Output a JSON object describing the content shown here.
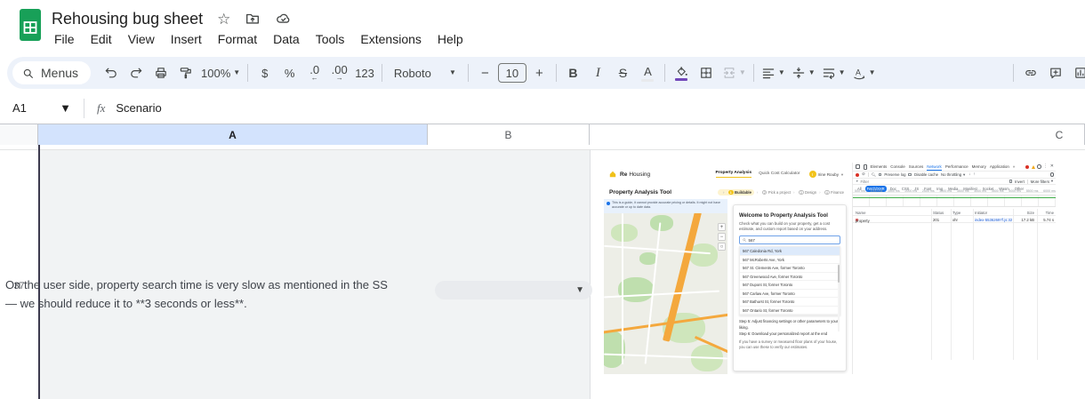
{
  "titlebar": {
    "title": "Rehousing bug sheet",
    "icons": {
      "star": "star-icon",
      "move": "move-to-folder-icon",
      "cloud": "cloud-saved-icon"
    }
  },
  "menubar": {
    "items": [
      "File",
      "Edit",
      "View",
      "Insert",
      "Format",
      "Data",
      "Tools",
      "Extensions",
      "Help"
    ]
  },
  "toolbar": {
    "menus_label": "Menus",
    "zoom": "100%",
    "currency": "$",
    "percent": "%",
    "decimal_decrease": ".0",
    "decimal_increase": ".00",
    "number_format": "123",
    "font_name": "Roboto",
    "font_size": "10",
    "bold": "B",
    "italic": "I",
    "strikethrough": "S",
    "text_color": "A"
  },
  "formula_bar": {
    "cell_ref": "A1",
    "fx": "fx",
    "content": "Scenario"
  },
  "sheet": {
    "columns": [
      "A",
      "B",
      "C"
    ],
    "selected_column": "A",
    "row_number": "37",
    "cell_text": "On the user side, property search time is very slow as mentioned in the SS — we should reduce it to **3 seconds or less**.",
    "dropdown_value": "",
    "colors": {
      "selected_header": "#d3e3fd",
      "row_fill": "#f1f3f4",
      "toolbar_bg": "#edf2fa",
      "sheets_green": "#18a058",
      "fill_accent": "#7248b9"
    }
  },
  "embedded_image": {
    "rehousing": {
      "brand_bold": "Re",
      "brand_rest": "Housing",
      "nav": [
        {
          "label": "Property Analysis",
          "active": true
        },
        {
          "label": "Quick Cost Calculator"
        }
      ],
      "user_initial": "I",
      "user_name": "Irine Rouby",
      "page_title": "Property Analysis Tool",
      "steps": [
        {
          "n": "1",
          "label": "Buildable",
          "active": true
        },
        {
          "n": "2",
          "label": "Pick a project"
        },
        {
          "n": "3",
          "label": "Design"
        },
        {
          "n": "4",
          "label": "Finance"
        }
      ],
      "banner": "This is a guide, it cannot provide accurate pricing or details. It might not have accurate or up to date data.",
      "map": {
        "zoom_in": "+",
        "zoom_out": "−",
        "locate": "○"
      },
      "panel": {
        "title": "Welcome to Property Analysis Tool",
        "subtitle": "Check what you can build on your property, get a cost estimate, and custom report based on your address.",
        "search_value": "567",
        "addresses": [
          {
            "label": "567 Caledonia Rd, York",
            "active": true
          },
          {
            "label": "567 McRoberts Ave, York"
          },
          {
            "label": "567 St. Clements Ave, former Toronto"
          },
          {
            "label": "567 Greenwood Ave, former Toronto"
          },
          {
            "label": "567 Dupont St, former Toronto"
          },
          {
            "label": "567 Carlaw Ave, former Toronto"
          },
          {
            "label": "567 Bathurst St, former Toronto"
          },
          {
            "label": "567 Ontario St, former Toronto"
          }
        ],
        "steps": [
          "Step 5:  Adjust financing settings or other parameters to your liking.",
          "Step 6:  Download your personalized report at the end"
        ],
        "note": "If you have a survey or measured floor plans of your house, you can use these to verify our estimates."
      },
      "accent": "#f2c31b"
    },
    "devtools": {
      "tabs": [
        {
          "label": "Elements"
        },
        {
          "label": "Console"
        },
        {
          "label": "Sources"
        },
        {
          "label": "Network",
          "active": true
        },
        {
          "label": "Performance"
        },
        {
          "label": "Memory"
        },
        {
          "label": "Application"
        },
        {
          "label": "»"
        }
      ],
      "toolbar": {
        "preserve_log": "Preserve log",
        "disable_cache": "Disable cache",
        "throttling": "No throttling"
      },
      "filter": {
        "placeholder": "Filter",
        "invert": "Invert",
        "more": "More filters"
      },
      "type_filters": [
        {
          "label": "All"
        },
        {
          "label": "Fetch/XHR",
          "active": true
        },
        {
          "label": "Doc"
        },
        {
          "label": "CSS"
        },
        {
          "label": "JS"
        },
        {
          "label": "Font"
        },
        {
          "label": "Img"
        },
        {
          "label": "Media"
        },
        {
          "label": "Manifest"
        },
        {
          "label": "Socket"
        },
        {
          "label": "Wasm"
        },
        {
          "label": "Other"
        }
      ],
      "timeline_ticks": [
        "500 ms",
        "1000 ms",
        "1500 ms",
        "2000 ms",
        "2500 ms",
        "3000 ms",
        "3500 ms",
        "4000 ms",
        "4500 ms",
        "5000 ms",
        "5500 ms",
        "6000 ms"
      ],
      "table": {
        "headers": [
          "Name",
          "Status",
          "Type",
          "Initiator",
          "Size",
          "Time"
        ],
        "rows": [
          {
            "name": "property",
            "status": "201",
            "type": "xhr",
            "initiator": "index-55362697f.js:323",
            "size": "17.2 kB",
            "time": "5.74 s"
          }
        ]
      },
      "accent": "#1a73e8"
    }
  }
}
